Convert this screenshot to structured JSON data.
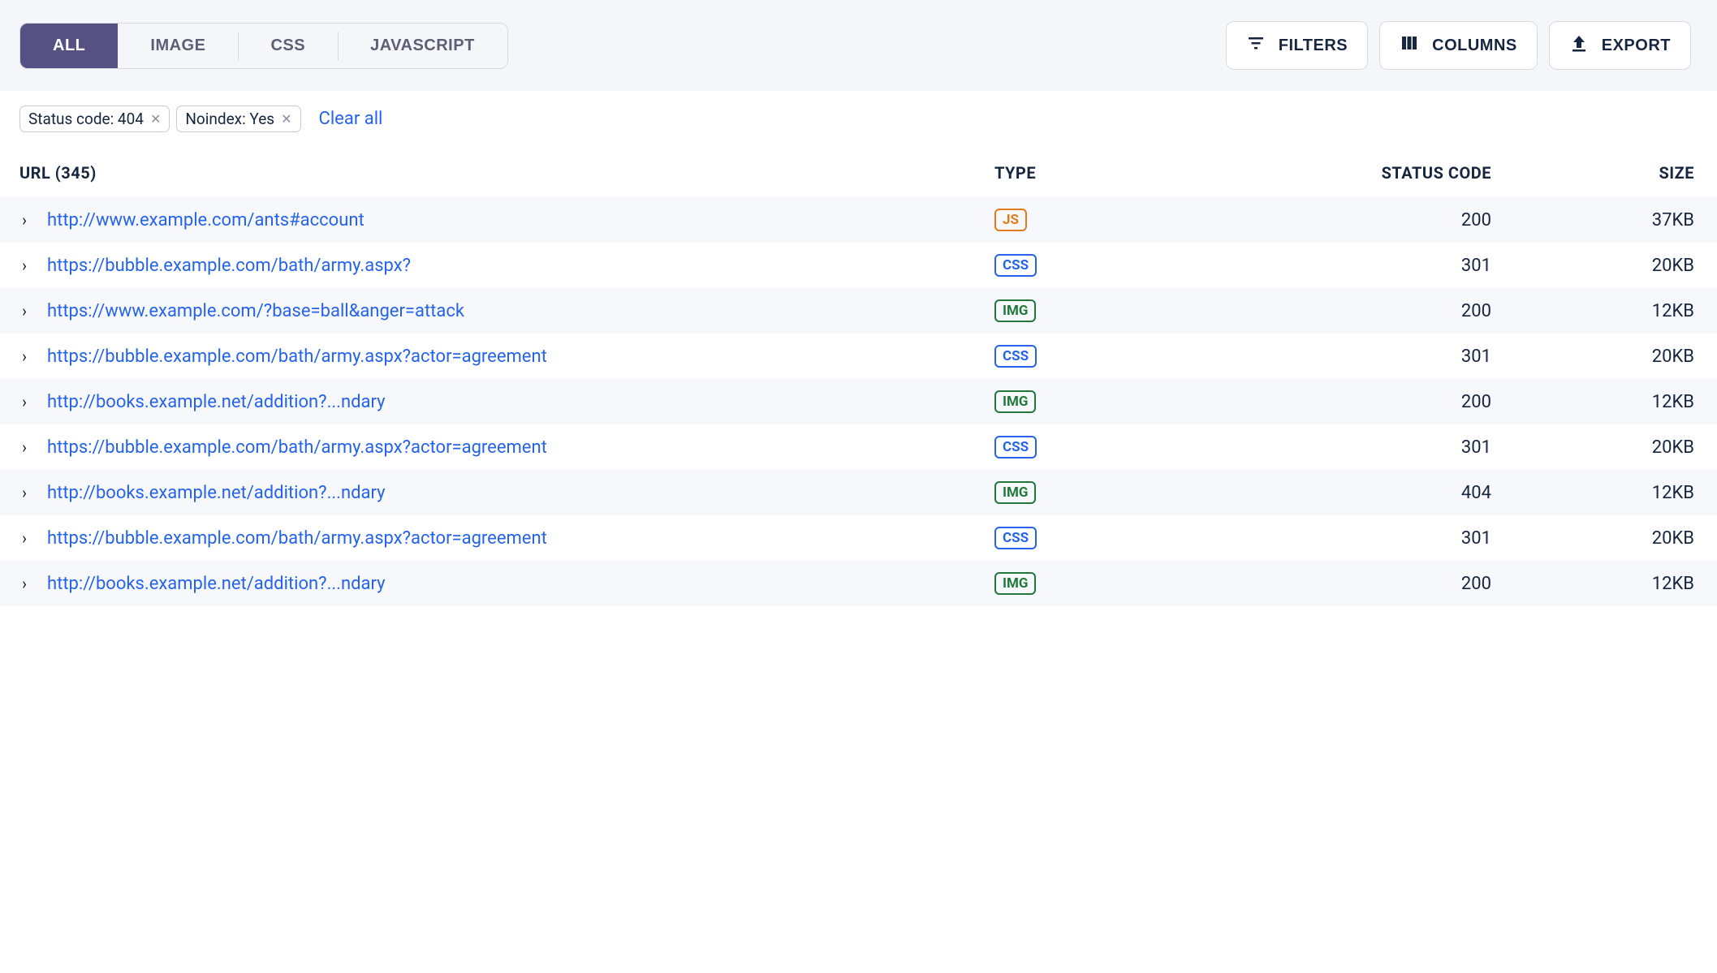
{
  "tabs": {
    "all": "ALL",
    "image": "IMAGE",
    "css": "CSS",
    "javascript": "JAVASCRIPT",
    "active": "all"
  },
  "actions": {
    "filters": "FILTERS",
    "columns": "COLUMNS",
    "export": "EXPORT"
  },
  "filters": {
    "chips": [
      {
        "label": "Status code: 404"
      },
      {
        "label": "Noindex: Yes"
      }
    ],
    "clear_all": "Clear all"
  },
  "table": {
    "headers": {
      "url": "URL (345)",
      "type": "TYPE",
      "status": "STATUS CODE",
      "size": "SIZE"
    },
    "rows": [
      {
        "url": "http://www.example.com/ants#account",
        "type": "JS",
        "status": "200",
        "size": "37KB"
      },
      {
        "url": "https://bubble.example.com/bath/army.aspx?",
        "type": "CSS",
        "status": "301",
        "size": "20KB"
      },
      {
        "url": "https://www.example.com/?base=ball&anger=attack",
        "type": "IMG",
        "status": "200",
        "size": "12KB"
      },
      {
        "url": "https://bubble.example.com/bath/army.aspx?actor=agreement",
        "type": "CSS",
        "status": "301",
        "size": "20KB"
      },
      {
        "url": "http://books.example.net/addition?...ndary",
        "type": "IMG",
        "status": "200",
        "size": "12KB"
      },
      {
        "url": "https://bubble.example.com/bath/army.aspx?actor=agreement",
        "type": "CSS",
        "status": "301",
        "size": "20KB"
      },
      {
        "url": "http://books.example.net/addition?...ndary",
        "type": "IMG",
        "status": "404",
        "size": "12KB"
      },
      {
        "url": "https://bubble.example.com/bath/army.aspx?actor=agreement",
        "type": "CSS",
        "status": "301",
        "size": "20KB"
      },
      {
        "url": "http://books.example.net/addition?...ndary",
        "type": "IMG",
        "status": "200",
        "size": "12KB"
      }
    ]
  }
}
